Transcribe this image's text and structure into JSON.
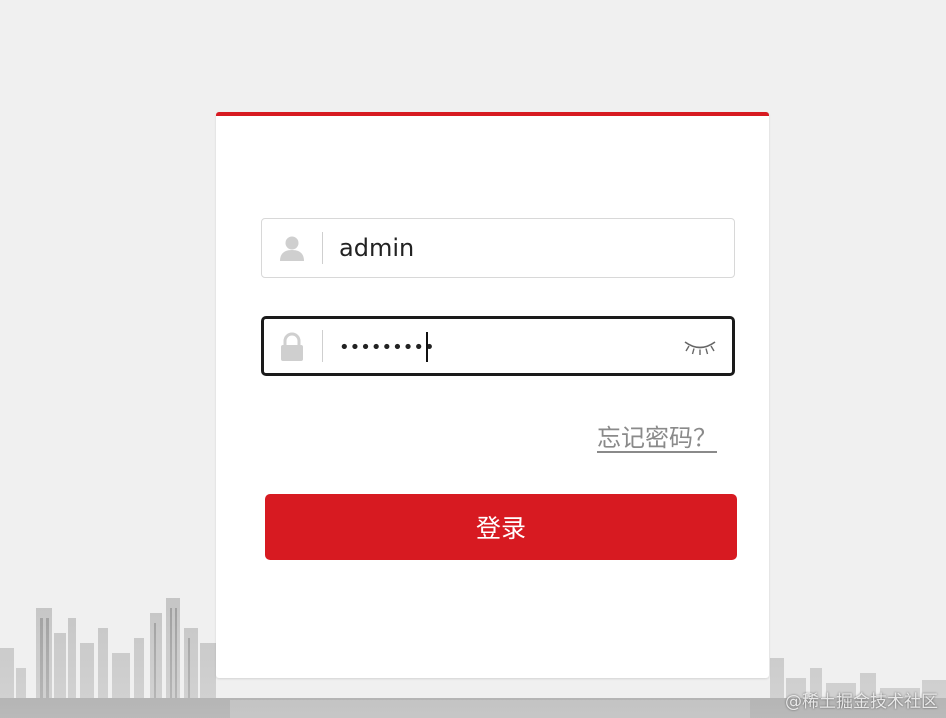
{
  "colors": {
    "accent": "#d71a21",
    "page_background": "#f0f0f0",
    "card_background": "#ffffff"
  },
  "login_form": {
    "username": {
      "icon": "user-icon",
      "value": "admin"
    },
    "password": {
      "icon": "lock-icon",
      "value": "•••••••••",
      "visibility_toggle_icon": "eye-closed-icon"
    },
    "forgot_password_label": "忘记密码？",
    "login_button_label": "登录"
  },
  "watermark": "@稀土掘金技术社区"
}
